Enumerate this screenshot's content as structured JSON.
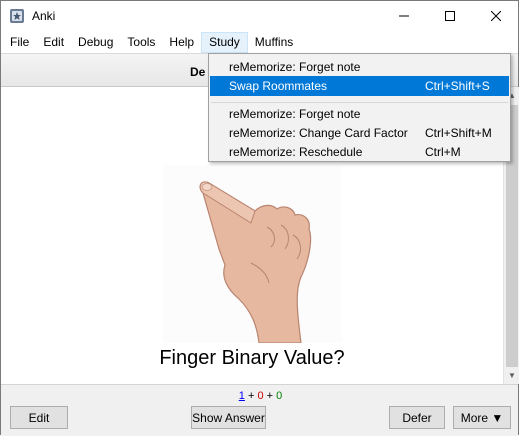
{
  "window": {
    "title": "Anki"
  },
  "menubar": {
    "items": [
      "File",
      "Edit",
      "Debug",
      "Tools",
      "Help",
      "Study",
      "Muffins"
    ]
  },
  "toolbar": {
    "link_partial": "De"
  },
  "dropdown": {
    "items": [
      {
        "label": "reMemorize: Forget note",
        "shortcut": ""
      },
      {
        "label": "Swap Roommates",
        "shortcut": "Ctrl+Shift+S"
      },
      {
        "label": "reMemorize: Forget note",
        "shortcut": ""
      },
      {
        "label": "reMemorize: Change Card Factor",
        "shortcut": "Ctrl+Shift+M"
      },
      {
        "label": "reMemorize: Reschedule",
        "shortcut": "Ctrl+M"
      }
    ]
  },
  "card": {
    "question": "Finger Binary Value?"
  },
  "counts": {
    "new": "1",
    "learn": "0",
    "review": "0",
    "plus": "+"
  },
  "buttons": {
    "edit": "Edit",
    "show_answer": "Show Answer",
    "defer": "Defer",
    "more": "More ▼"
  },
  "colors": {
    "highlight": "#0078d7",
    "new_count": "#0000ff",
    "learn_count": "#cc0000",
    "review_count": "#008000"
  }
}
